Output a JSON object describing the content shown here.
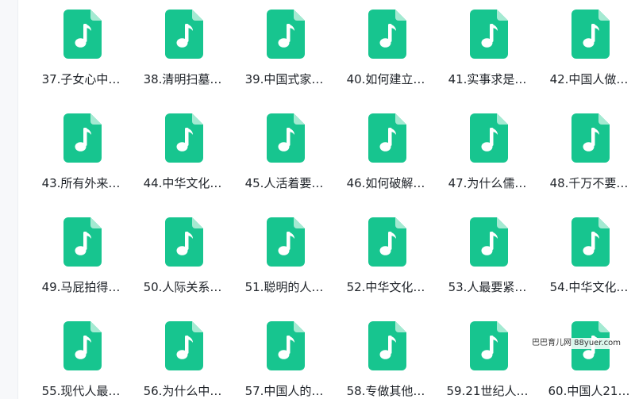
{
  "colors": {
    "icon_fill": "#17c58f",
    "icon_fold": "#a4ead2",
    "icon_note": "#ffffff",
    "text": "#1f2329"
  },
  "icon_name": "music-file-icon",
  "files": [
    {
      "label": "37.子女心中…"
    },
    {
      "label": "38.清明扫墓…"
    },
    {
      "label": "39.中国式家…"
    },
    {
      "label": "40.如何建立…"
    },
    {
      "label": "41.实事求是…"
    },
    {
      "label": "42.中国人做…"
    },
    {
      "label": "43.所有外来…"
    },
    {
      "label": "44.中华文化…"
    },
    {
      "label": "45.人活着要…"
    },
    {
      "label": "46.如何破解…"
    },
    {
      "label": "47.为什么儒…"
    },
    {
      "label": "48.千万不要…"
    },
    {
      "label": "49.马屁拍得…"
    },
    {
      "label": "50.人际关系…"
    },
    {
      "label": "51.聪明的人…"
    },
    {
      "label": "52.中华文化…"
    },
    {
      "label": "53.人最要紧…"
    },
    {
      "label": "54.中华文化…"
    },
    {
      "label": "55.现代人最…"
    },
    {
      "label": "56.为什么中…"
    },
    {
      "label": "57.中国人的…"
    },
    {
      "label": "58.专做其他…"
    },
    {
      "label": "59.21世纪人…"
    },
    {
      "label": "60.中国人21…"
    }
  ],
  "watermark": "巴巴育儿网 88yuer.com"
}
